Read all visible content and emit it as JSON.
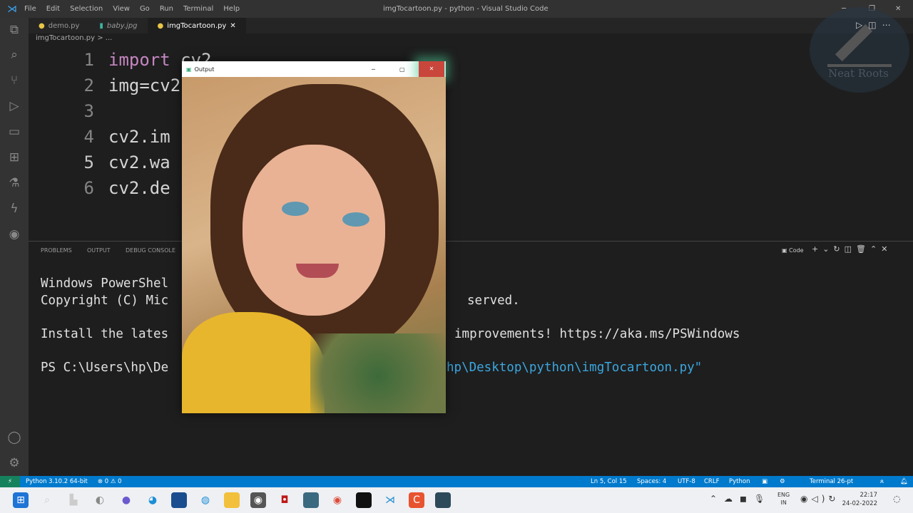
{
  "titlebar": {
    "menu": [
      "File",
      "Edit",
      "Selection",
      "View",
      "Go",
      "Run",
      "Terminal",
      "Help"
    ],
    "title": "imgTocartoon.py - python - Visual Studio Code"
  },
  "tabs": [
    {
      "label": "demo.py"
    },
    {
      "label": "baby.jpg"
    },
    {
      "label": "imgTocartoon.py",
      "close": "✕"
    }
  ],
  "breadcrumb": "imgTocartoon.py > ...",
  "editor": {
    "lines": [
      {
        "n": "1",
        "kw": "import",
        "rest": " cv2"
      },
      {
        "n": "2",
        "kw": "",
        "rest": "img=cv2"
      },
      {
        "n": "3",
        "kw": "",
        "rest": ""
      },
      {
        "n": "4",
        "kw": "",
        "rest": "cv2.im"
      },
      {
        "n": "5",
        "kw": "",
        "rest": "cv2.wa"
      },
      {
        "n": "6",
        "kw": "",
        "rest": "cv2.de"
      }
    ]
  },
  "panel": {
    "tabs": [
      "PROBLEMS",
      "OUTPUT",
      "DEBUG CONSOLE"
    ],
    "shell_label": "Code",
    "terminal": [
      {
        "left": "Windows PowerShel",
        "right": ""
      },
      {
        "left": "Copyright (C) Mic",
        "right": "served."
      },
      {
        "left": "Install the lates",
        "right": "improvements! https://aka.ms/PSWindows"
      },
      {
        "left": "PS C:\\Users\\hp\\De",
        "right": "hp\\Desktop\\python\\imgTocartoon.py\""
      }
    ]
  },
  "output_window": {
    "title": "Output"
  },
  "watermark": "Neat Roots",
  "status": {
    "python": "Python 3.10.2 64-bit",
    "problems": "⊗ 0 ⚠ 0",
    "position": "Ln 5, Col 15",
    "spaces": "Spaces: 4",
    "encoding": "UTF-8",
    "eol": "CRLF",
    "language": "Python",
    "terminal": "Terminal 26-pt"
  },
  "taskbar": {
    "lang": "ENG",
    "region": "IN",
    "time": "22:17",
    "date": "24-02-2022"
  },
  "colors": {
    "accent": "#007acc",
    "remote": "#16825d"
  }
}
